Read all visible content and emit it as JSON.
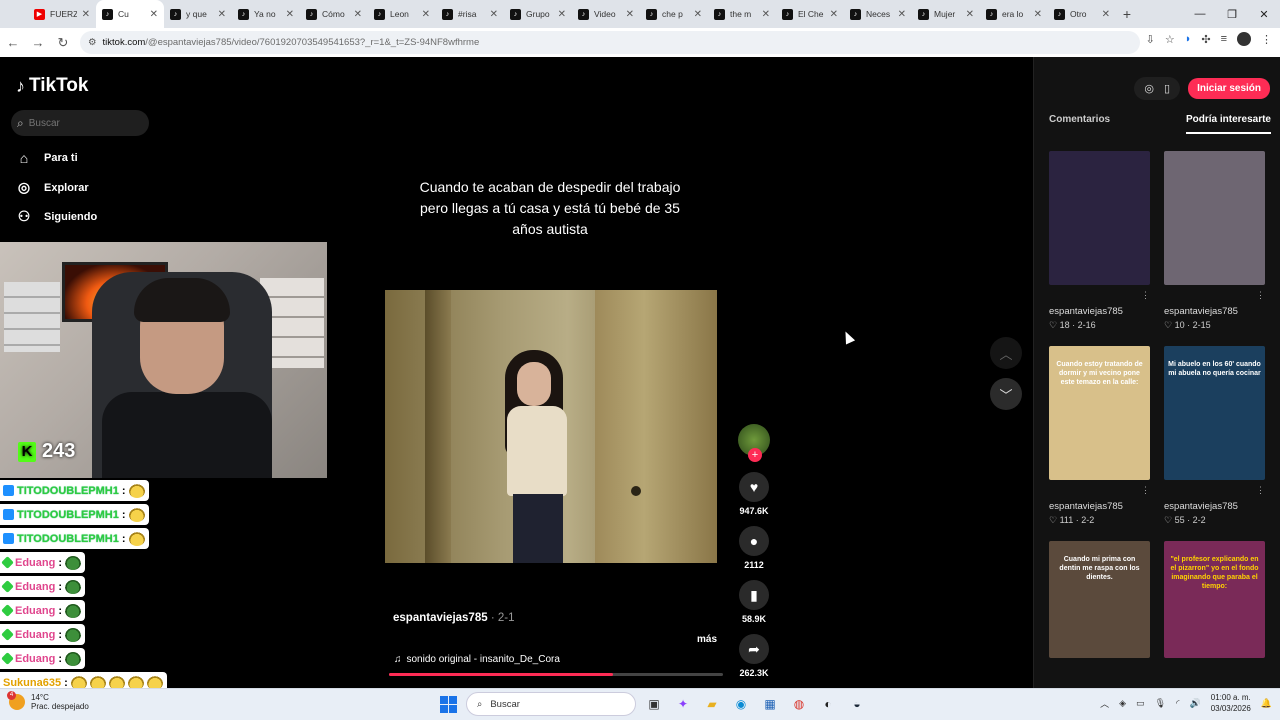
{
  "browser": {
    "tabs": [
      {
        "title": "FUERZ",
        "icon": "youtube-icon",
        "active": false
      },
      {
        "title": "Cu",
        "icon": "tiktok-icon",
        "active": true
      },
      {
        "title": "y que",
        "icon": "tiktok-icon",
        "active": false
      },
      {
        "title": "Ya no",
        "icon": "tiktok-icon",
        "active": false
      },
      {
        "title": "Cómo",
        "icon": "tiktok-icon",
        "active": false
      },
      {
        "title": "Leon",
        "icon": "tiktok-icon",
        "active": false
      },
      {
        "title": "#risa",
        "icon": "tiktok-icon",
        "active": false
      },
      {
        "title": "Grupo",
        "icon": "tiktok-icon",
        "active": false
      },
      {
        "title": "Video",
        "icon": "tiktok-icon",
        "active": false
      },
      {
        "title": "che p",
        "icon": "tiktok-icon",
        "active": false
      },
      {
        "title": "the m",
        "icon": "tiktok-icon",
        "active": false
      },
      {
        "title": "El Che",
        "icon": "tiktok-icon",
        "active": false
      },
      {
        "title": "Neces",
        "icon": "tiktok-icon",
        "active": false
      },
      {
        "title": "Mujer",
        "icon": "tiktok-icon",
        "active": false
      },
      {
        "title": "era lo",
        "icon": "tiktok-icon",
        "active": false
      },
      {
        "title": "Otro",
        "icon": "tiktok-icon",
        "active": false
      }
    ],
    "url_host": "tiktok.com",
    "url_path": "/@espantaviejas785/video/7601920703549541653?_r=1&_t=ZS-94NF8wfhrme"
  },
  "sidebar": {
    "logo": "TikTok",
    "search_placeholder": "Buscar",
    "items": [
      {
        "label": "Para ti",
        "icon": "home-icon"
      },
      {
        "label": "Explorar",
        "icon": "compass-icon"
      },
      {
        "label": "Siguiendo",
        "icon": "person-icon"
      }
    ]
  },
  "stream": {
    "kick_count": "243",
    "chat": [
      {
        "user": "TITODOUBLEPMH1",
        "color": "green",
        "badge": "blue",
        "emotes": 1
      },
      {
        "user": "TITODOUBLEPMH1",
        "color": "green",
        "badge": "blue",
        "emotes": 1
      },
      {
        "user": "TITODOUBLEPMH1",
        "color": "green",
        "badge": "blue",
        "emotes": 1
      },
      {
        "user": "Eduang",
        "color": "pink",
        "badge": "green",
        "emotes": 1
      },
      {
        "user": "Eduang",
        "color": "pink",
        "badge": "green",
        "emotes": 1
      },
      {
        "user": "Eduang",
        "color": "pink",
        "badge": "green",
        "emotes": 1
      },
      {
        "user": "Eduang",
        "color": "pink",
        "badge": "green",
        "emotes": 1
      },
      {
        "user": "Eduang",
        "color": "pink",
        "badge": "green",
        "emotes": 1
      },
      {
        "user": "Sukuna635",
        "color": "yellow",
        "badge": "none",
        "emotes": 5
      }
    ]
  },
  "video": {
    "caption": "Cuando te acaban de despedir del trabajo pero llegas a tú casa y está tú bebé de 35 años autista",
    "author": "espantaviejas785",
    "date": " · 2-1",
    "more": "más",
    "sound": "sonido original - insanito_De_Cora",
    "progress": 0.67,
    "likes": "947.6K",
    "comments": "2112",
    "saves": "58.9K",
    "shares": "262.3K"
  },
  "panel": {
    "login": "Iniciar sesión",
    "tabs": [
      "Comentarios",
      "Podría interesarte"
    ],
    "active_tab": 1,
    "items": [
      {
        "user": "espantaviejas785",
        "likes": "18",
        "date": "2-16",
        "caption": "",
        "caption_color": "white",
        "bg": "#2b2340"
      },
      {
        "user": "espantaviejas785",
        "likes": "10",
        "date": "2-15",
        "caption": "",
        "caption_color": "white",
        "bg": "#6e6672"
      },
      {
        "user": "espantaviejas785",
        "likes": "111",
        "date": "2-2",
        "caption": "Cuando estoy tratando de dormir y mi vecino pone este temazo en la calle:",
        "caption_color": "white",
        "bg": "#d8c08a"
      },
      {
        "user": "espantaviejas785",
        "likes": "55",
        "date": "2-2",
        "caption": "Mi abuelo en los 60' cuando mi abuela no quería cocinar",
        "caption_color": "white",
        "bg": "#1b3f5e"
      },
      {
        "user": "",
        "likes": "",
        "date": "",
        "caption": "Cuando mi prima con dentin me raspa con los dientes.",
        "caption_color": "white",
        "bg": "#5b4a3c"
      },
      {
        "user": "",
        "likes": "",
        "date": "",
        "caption": "\"el profesor explicando en el pizarron\" yo en el fondo imaginando que paraba el tiempo:",
        "caption_color": "yellow",
        "bg": "#7a2a58"
      }
    ]
  },
  "taskbar": {
    "temp": "14°C",
    "weather": "Prac. despejado",
    "notif": "4",
    "search": "Buscar",
    "time": "01:00 a. m.",
    "date": "03/03/2026"
  }
}
